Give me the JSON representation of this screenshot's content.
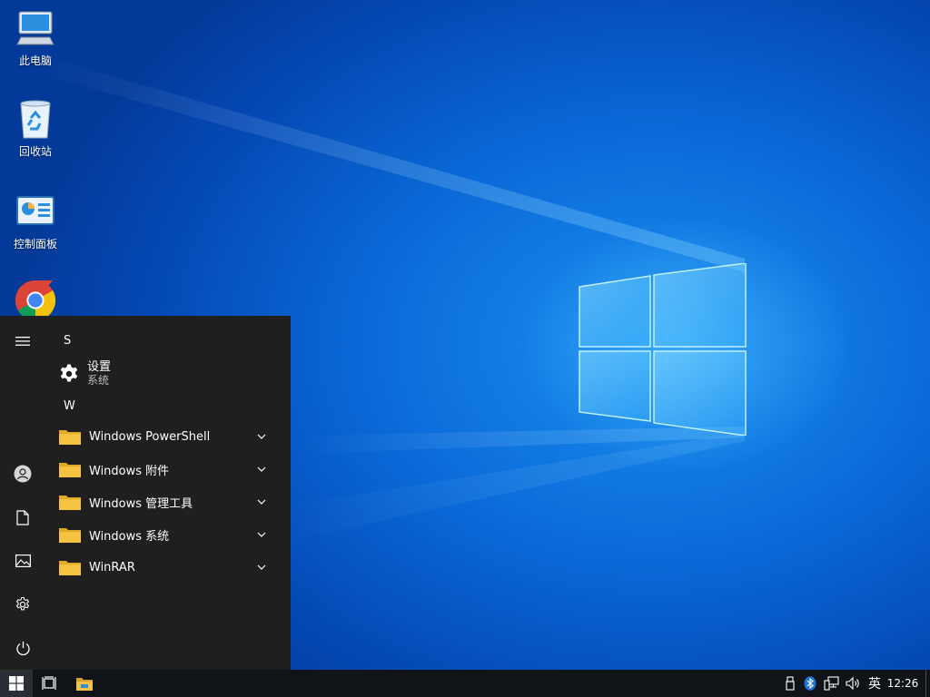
{
  "desktop": {
    "icons": [
      {
        "label": "此电脑",
        "icon": "computer-icon"
      },
      {
        "label": "回收站",
        "icon": "recycle-bin-icon"
      },
      {
        "label": "控制面板",
        "icon": "control-panel-icon"
      },
      {
        "label": "",
        "icon": "chrome-icon"
      }
    ]
  },
  "start_menu": {
    "sections": [
      {
        "letter": "S",
        "apps": [
          {
            "name": "设置",
            "subtitle": "系统",
            "icon": "gear-icon"
          }
        ]
      },
      {
        "letter": "W",
        "apps": [
          {
            "name": "Windows PowerShell",
            "icon": "folder-icon",
            "expandable": true
          },
          {
            "name": "Windows 附件",
            "icon": "folder-icon",
            "expandable": true
          },
          {
            "name": "Windows 管理工具",
            "icon": "folder-icon",
            "expandable": true
          },
          {
            "name": "Windows 系统",
            "icon": "folder-icon",
            "expandable": true
          },
          {
            "name": "WinRAR",
            "icon": "folder-icon",
            "expandable": true
          }
        ]
      }
    ],
    "rail": [
      "hamburger-icon",
      "user-icon",
      "document-icon",
      "pictures-icon",
      "settings-icon",
      "power-icon"
    ]
  },
  "taskbar": {
    "pinned": [
      "start-icon",
      "task-view-icon",
      "file-explorer-icon"
    ],
    "tray": [
      "usb-icon",
      "bluetooth-icon",
      "network-icon",
      "volume-icon"
    ],
    "ime": "英",
    "clock": "12:26"
  },
  "colors": {
    "start_menu_bg": "#1f1f1f",
    "taskbar_bg": "#101317",
    "folder_yellow": "#f5c342",
    "desktop_blue": "#0a6ad8"
  }
}
